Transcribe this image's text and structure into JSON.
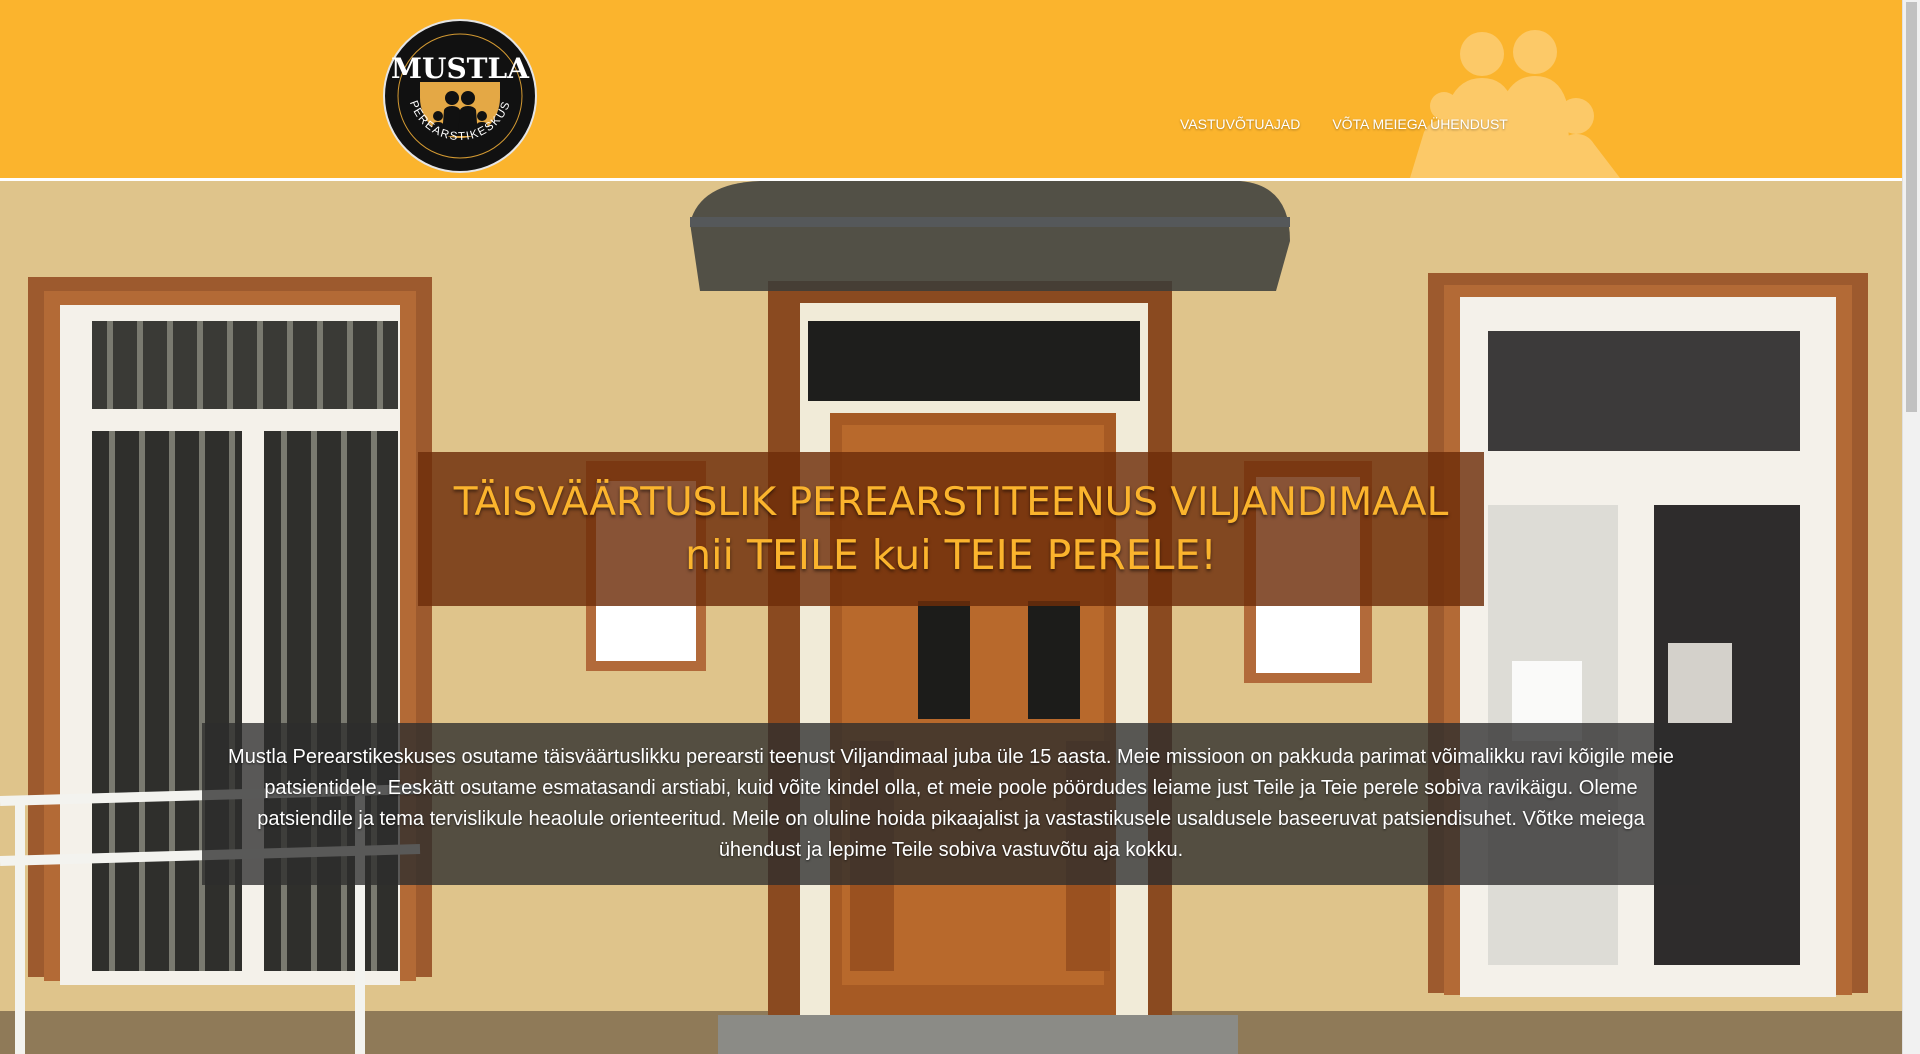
{
  "header": {
    "background_color": "#fbb42d",
    "logo": {
      "name": "MUSTLA",
      "subtitle": "PEREARSTIKESKUS",
      "icon": "family-icon"
    },
    "nav": [
      {
        "label": "VASTUVÕTUAJAD"
      },
      {
        "label": "VÕTA MEIEGA ÜHENDUST"
      }
    ],
    "watermark_icon": "family-watermark-icon"
  },
  "hero": {
    "headline_line1": "TÄISVÄÄRTUSLIK PEREARSTITEENUS VILJANDIMAAL",
    "headline_line2": "nii TEILE kui TEIE PERELE!",
    "headline_color": "#fbb42d",
    "intro": "Mustla Perearstikeskuses osutame täisväärtuslikku perearsti teenust Viljandimaal juba üle 15 aasta. Meie missioon on pakkuda parimat võimalikku ravi kõigile meie patsientidele. Eeskätt osutame esmatasandi arstiabi, kuid võite kindel olla, et meie poole pöördudes leiame just Teile ja Teie perele sobiva ravikäigu. Oleme patsiendile ja tema tervislikule heaolule orienteeritud. Meile on oluline hoida pikaajalist ja vastastikusele usaldusele baseeruvat patsiendisuhet. Võtke meiega ühendust ja lepime Teile sobiva vastuvõtu aja kokku."
  }
}
